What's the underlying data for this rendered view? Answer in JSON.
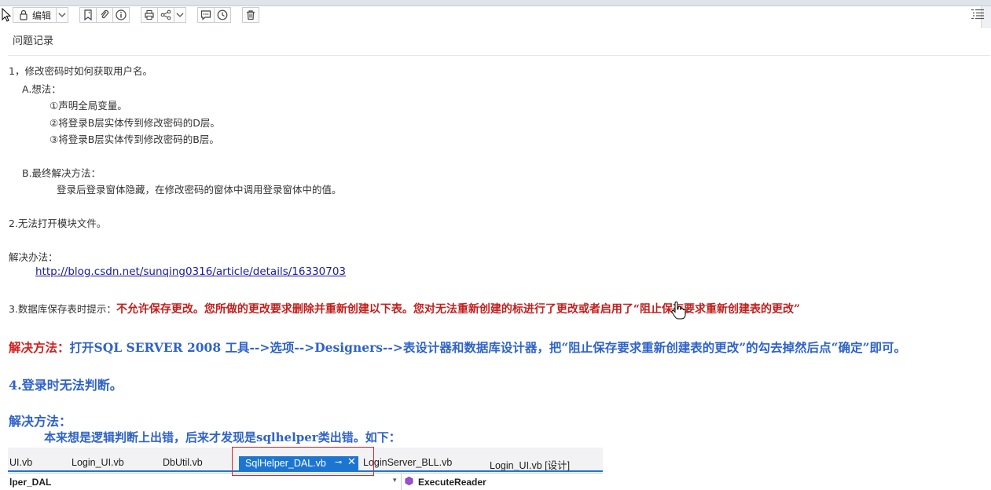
{
  "toolbar": {
    "edit_label": "编辑",
    "icons": [
      "lock-icon",
      "dropdown-icon",
      "bookmark-icon",
      "attachment-icon",
      "info-icon",
      "print-icon",
      "share-icon",
      "comment-icon",
      "clock-icon",
      "delete-icon",
      "outline-icon"
    ]
  },
  "note": {
    "title": "问题记录",
    "lines": {
      "l1": "1，修改密码时如何获取用户名。",
      "l2": "A.想法：",
      "l3": "①声明全局变量。",
      "l4": "②将登录B层实体传到修改密码的D层。",
      "l5": "③将登录B层实体传到修改密码的B层。",
      "l6": "B.最终解决方法：",
      "l7": "登录后登录窗体隐藏，在修改密码的窗体中调用登录窗体中的值。",
      "l8": "2.无法打开模块文件。",
      "l9": "解决办法：",
      "link": "http://blog.csdn.net/sunqing0316/article/details/16330703",
      "l10_prefix": "3.数据库保存表时提示：",
      "l10_red": "不允许保存更改。您所做的更改要求删除并重新创建以下表。您对无法重新创建的标进行了更改或者启用了“阻止保存要求重新创建表的更改”",
      "l11_label": "解决方法：",
      "l11_text": "打开SQL SERVER 2008 工具-->选项-->Designers-->表设计器和数据库设计器，把“阻止保存要求重新创建表的更改”的勾去掉然后点“确定”即可。",
      "l12": "4.登录时无法判断。",
      "l13": "解决方法：",
      "l14": "本来想是逻辑判断上出错，后来才发现是sqlhelper类出错。如下："
    }
  },
  "vs_screenshot": {
    "tabs": [
      "UI.vb",
      "Login_UI.vb",
      "DbUtil.vb",
      "SqlHelper_DAL.vb",
      "LoginServer_BLL.vb",
      "Login_UI.vb [设计]"
    ],
    "active_tab": "SqlHelper_DAL.vb",
    "nav_left": "lper_DAL",
    "nav_right": "ExecuteReader",
    "colors": {
      "active_tab": "#1c76d1",
      "highlight_box": "#e0242a"
    }
  },
  "colors": {
    "red_text": "#c0201d",
    "blue_text": "#2f63c8",
    "link": "#1a1aa6"
  }
}
